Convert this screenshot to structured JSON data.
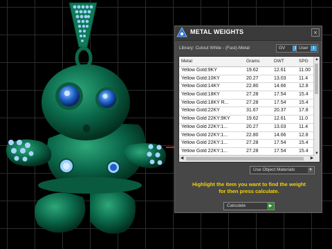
{
  "colors": {
    "body": "#0b6a4c",
    "accent_blue": "#3a8de0",
    "highlight_yellow": "#f5d400",
    "table_bg": "#ffffff",
    "panel_bg": "#474747"
  },
  "viewport": {
    "icon": "jewelry-pendant-3d-model"
  },
  "panel": {
    "title": "METAL WEIGHTS",
    "title_icon": "app-logo-icon",
    "close_label": "×",
    "library_label": "Library: Cutout White - (Fast)-Metal",
    "gv_label": "GV",
    "gv_tag": "i",
    "user_label": "User",
    "user_tag": "i",
    "columns": [
      "Metal",
      "Grams",
      "DWT",
      "SPG"
    ],
    "rows": [
      [
        "Yellow Gold:9KY",
        "19.62",
        "12.61",
        "11.00"
      ],
      [
        "Yellow Gold:10KY",
        "20.27",
        "13.03",
        "11.4"
      ],
      [
        "Yellow Gold:14KY",
        "22.80",
        "14.66",
        "12.8"
      ],
      [
        "Yellow Gold:18KY",
        "27.28",
        "17.54",
        "15.4"
      ],
      [
        "Yellow Gold:18KY R...",
        "27.28",
        "17.54",
        "15.4"
      ],
      [
        "Yellow Gold:22KY",
        "31.67",
        "20.37",
        "17.8"
      ],
      [
        "Yellow Gold 22KY:9KY",
        "19.62",
        "12.61",
        "11.0"
      ],
      [
        "Yellow Gold 22KY:1...",
        "20.27",
        "13.03",
        "11.4"
      ],
      [
        "Yellow Gold 22KY:1...",
        "22.80",
        "14.66",
        "12.8"
      ],
      [
        "Yellow Gold 22KY:1...",
        "27.28",
        "17.54",
        "15.4"
      ],
      [
        "Yellow Gold 22KY:1...",
        "27.28",
        "17.54",
        "15.4"
      ]
    ],
    "use_materials_label": "Use Object Materials",
    "hint_line1": "Highlight the item you want to find the weight",
    "hint_line2": "for then press calculate.",
    "calculate_label": "Calculate"
  }
}
